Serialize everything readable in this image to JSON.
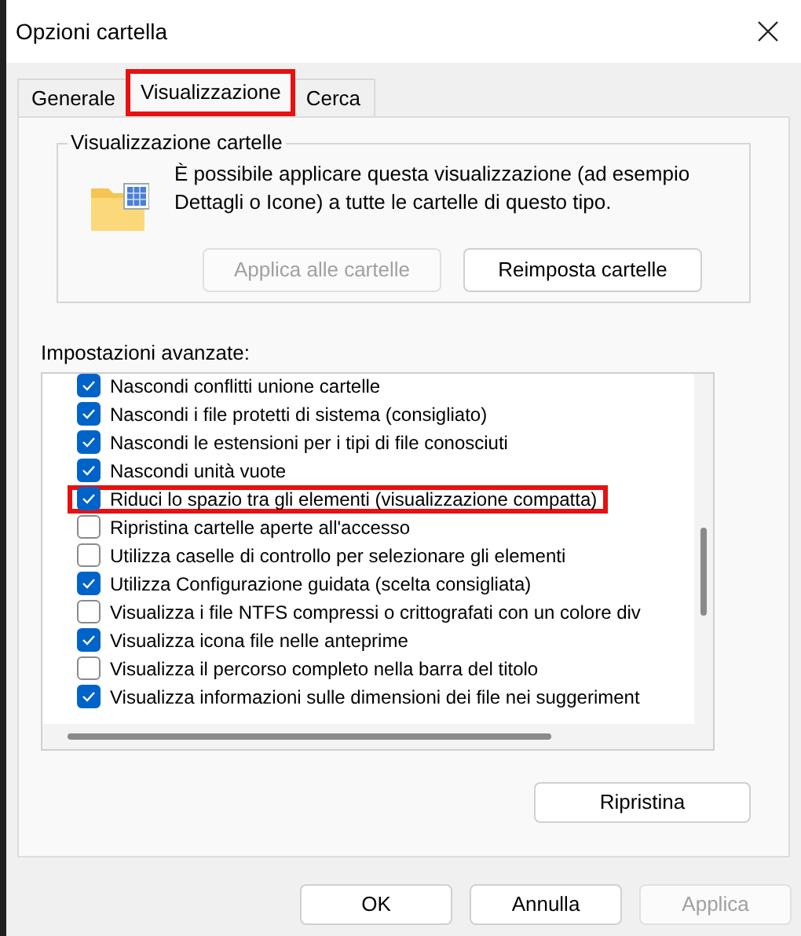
{
  "window": {
    "title": "Opzioni cartella"
  },
  "tabs": [
    {
      "label": "Generale",
      "selected": false,
      "highlighted": false
    },
    {
      "label": "Visualizzazione",
      "selected": true,
      "highlighted": true
    },
    {
      "label": "Cerca",
      "selected": false,
      "highlighted": false
    }
  ],
  "folder_views": {
    "title": "Visualizzazione cartelle",
    "description": "È possibile applicare questa visualizzazione (ad esempio Dettagli o Icone) a tutte le cartelle di questo tipo.",
    "buttons": [
      {
        "label": "Applica alle cartelle",
        "disabled": true
      },
      {
        "label": "Reimposta cartelle",
        "disabled": false
      }
    ]
  },
  "advanced": {
    "label": "Impostazioni avanzate:",
    "items": [
      {
        "label": "Nascondi conflitti unione cartelle",
        "checked": true,
        "highlighted": false
      },
      {
        "label": "Nascondi i file protetti di sistema (consigliato)",
        "checked": true,
        "highlighted": false
      },
      {
        "label": "Nascondi le estensioni per i tipi di file conosciuti",
        "checked": true,
        "highlighted": false
      },
      {
        "label": "Nascondi unità vuote",
        "checked": true,
        "highlighted": false
      },
      {
        "label": "Riduci lo spazio tra gli elementi (visualizzazione compatta)",
        "checked": true,
        "highlighted": true
      },
      {
        "label": "Ripristina cartelle aperte all'accesso",
        "checked": false,
        "highlighted": false
      },
      {
        "label": "Utilizza caselle di controllo per selezionare gli elementi",
        "checked": false,
        "highlighted": false
      },
      {
        "label": "Utilizza Configurazione guidata (scelta consigliata)",
        "checked": true,
        "highlighted": false
      },
      {
        "label": "Visualizza i file NTFS compressi o crittografati con un colore div",
        "checked": false,
        "highlighted": false
      },
      {
        "label": "Visualizza icona file nelle anteprime",
        "checked": true,
        "highlighted": false
      },
      {
        "label": "Visualizza il percorso completo nella barra del titolo",
        "checked": false,
        "highlighted": false
      },
      {
        "label": "Visualizza informazioni sulle dimensioni dei file nei suggeriment",
        "checked": true,
        "highlighted": false
      }
    ],
    "restore_button": {
      "label": "Ripristina",
      "disabled": false
    }
  },
  "footer_buttons": [
    {
      "label": "OK",
      "disabled": false
    },
    {
      "label": "Annulla",
      "disabled": false
    },
    {
      "label": "Applica",
      "disabled": true
    }
  ]
}
